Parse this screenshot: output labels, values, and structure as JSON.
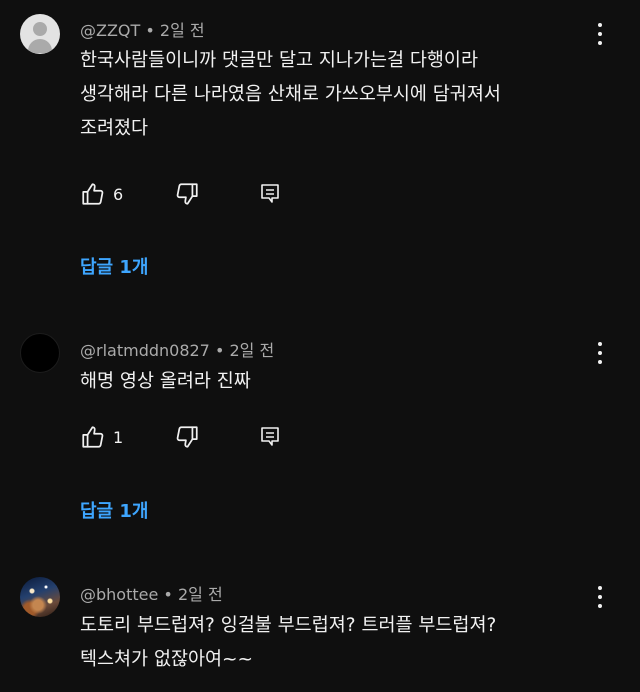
{
  "comments": [
    {
      "author": "@ZZQT",
      "age": "2일 전",
      "lines": [
        "한국사람들이니까 댓글만 달고 지나가는걸 다행이라",
        "생각해라 다른 나라였음 산채로 가쓰오부시에 담궈져서",
        "조려졌다"
      ],
      "likes": "6",
      "replies": "답글 1개"
    },
    {
      "author": "@rlatmddn0827",
      "age": "2일 전",
      "lines": [
        "해명 영상 올려라 진짜"
      ],
      "likes": "1",
      "replies": "답글 1개"
    },
    {
      "author": "@bhottee",
      "age": "2일 전",
      "lines": [
        "도토리 부드럽져? 잉걸불 부드럽져? 트러플 부드럽져?",
        "텍스쳐가 없잖아여~~"
      ]
    }
  ],
  "separator": "•",
  "colors": {
    "background": "#0f0f0f",
    "text": "#f1f1f1",
    "meta": "#aaaaaa",
    "link": "#3ea6ff"
  },
  "icons": [
    "default-avatar-icon",
    "thumbs-up-icon",
    "thumbs-down-icon",
    "reply-icon",
    "more-vert-icon"
  ]
}
